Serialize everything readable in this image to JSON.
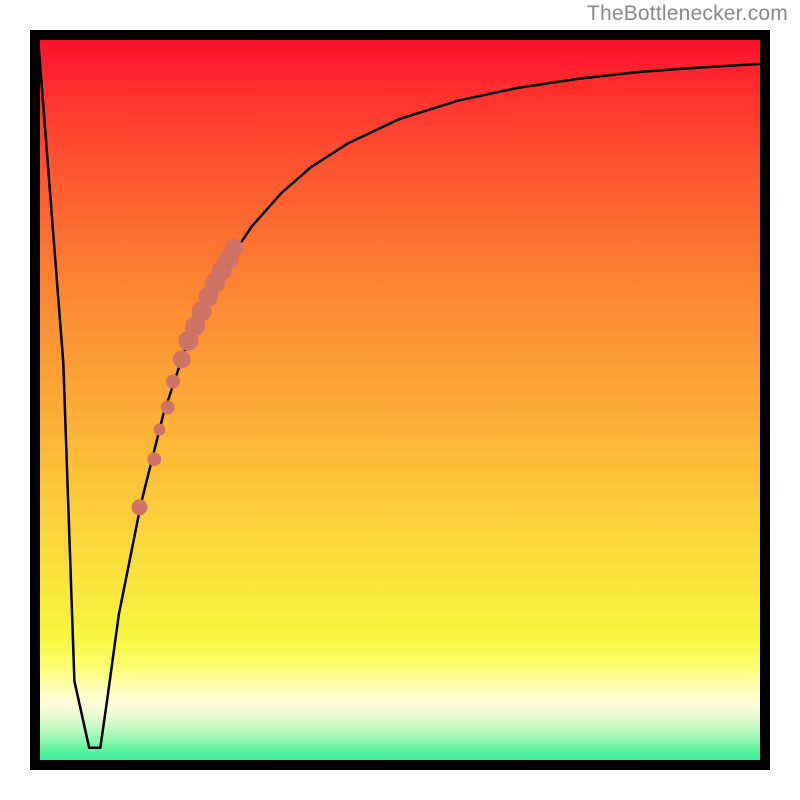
{
  "attribution": "TheBottlenecker.com",
  "chart_data": {
    "type": "line",
    "title": "",
    "xlabel": "",
    "ylabel": "",
    "xlim": [
      0,
      100
    ],
    "ylim": [
      0,
      100
    ],
    "series": [
      {
        "name": "bottleneck-curve",
        "x": [
          1,
          4.5,
          6,
          8,
          9.5,
          10.5,
          12,
          15,
          18,
          21,
          24,
          27,
          30,
          34,
          38,
          43,
          50,
          58,
          66,
          74,
          82,
          90,
          100
        ],
        "y": [
          100,
          55,
          12,
          3,
          3,
          10,
          21,
          36,
          48,
          57,
          63.5,
          69,
          73.5,
          78,
          81.5,
          84.7,
          88,
          90.5,
          92.2,
          93.4,
          94.3,
          94.9,
          95.5
        ]
      }
    ],
    "dots": {
      "name": "highlight-dots",
      "points": [
        {
          "x": 14.8,
          "y": 35.5,
          "r": 8
        },
        {
          "x": 16.8,
          "y": 42.0,
          "r": 7
        },
        {
          "x": 17.5,
          "y": 46.0,
          "r": 6
        },
        {
          "x": 18.6,
          "y": 49.0,
          "r": 7
        },
        {
          "x": 19.3,
          "y": 52.5,
          "r": 7
        },
        {
          "x": 20.5,
          "y": 55.5,
          "r": 9
        },
        {
          "x": 21.4,
          "y": 58.0,
          "r": 10
        },
        {
          "x": 22.3,
          "y": 60.0,
          "r": 10
        },
        {
          "x": 23.2,
          "y": 62.0,
          "r": 10
        },
        {
          "x": 24.1,
          "y": 64.0,
          "r": 10
        },
        {
          "x": 25.0,
          "y": 65.8,
          "r": 10
        },
        {
          "x": 25.9,
          "y": 67.5,
          "r": 10
        },
        {
          "x": 26.8,
          "y": 69.0,
          "r": 10
        },
        {
          "x": 27.6,
          "y": 70.6,
          "r": 9
        }
      ]
    },
    "background_gradient_stops": [
      {
        "pos": 0.0,
        "color": "#ff0a2c"
      },
      {
        "pos": 0.2,
        "color": "#ff5930"
      },
      {
        "pos": 0.48,
        "color": "#fca435"
      },
      {
        "pos": 0.74,
        "color": "#fae33d"
      },
      {
        "pos": 0.86,
        "color": "#fdfe6f"
      },
      {
        "pos": 0.93,
        "color": "#e2fbcf"
      },
      {
        "pos": 1.0,
        "color": "#1fec8f"
      }
    ]
  }
}
